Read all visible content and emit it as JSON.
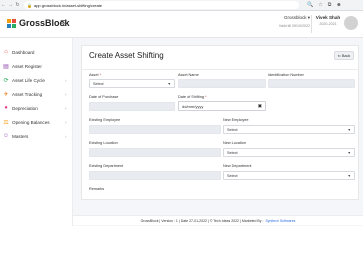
{
  "browser": {
    "url": "app.grossblock.in/asset-shifting/create"
  },
  "header": {
    "brand": "GrossBlock",
    "company_name": "Grossblock",
    "company_caret": "▾",
    "fiscal_year": "Valid till 09/10/2022",
    "user_name": "Vivek Shah",
    "user_year": "2020-2021"
  },
  "sidebar": {
    "items": [
      {
        "label": "Dashboard",
        "icon": "home-icon",
        "glyph": "⌂",
        "color": "#e74c3c",
        "chevron": false
      },
      {
        "label": "Asset Register",
        "icon": "register-icon",
        "glyph": "▤",
        "color": "#8e44ad",
        "chevron": false
      },
      {
        "label": "Asset Life Cycle",
        "icon": "lifecycle-icon",
        "glyph": "⟳",
        "color": "#27ae60",
        "chevron": true
      },
      {
        "label": "Asset Tracking",
        "icon": "tracking-icon",
        "glyph": "✈",
        "color": "#e67e22",
        "chevron": true
      },
      {
        "label": "Depreciation",
        "icon": "depreciation-icon",
        "glyph": "●",
        "color": "#e84393",
        "chevron": true
      },
      {
        "label": "Opening Balances",
        "icon": "balance-icon",
        "glyph": "⚖",
        "color": "#f39c12",
        "chevron": true
      },
      {
        "label": "Masters",
        "icon": "masters-icon",
        "glyph": "☺",
        "color": "#9b59b6",
        "chevron": true
      }
    ]
  },
  "form": {
    "title": "Create Asset Shifting",
    "back_label": "⇐ Back",
    "asset_label": "Asset",
    "asset_value": "Select",
    "asset_name_label": "Asset Name",
    "identification_label": "Identification Number",
    "purchase_label": "Date of Purchase",
    "shifting_label": "Date of Shifting",
    "shifting_placeholder": "dd/mm/yyyy",
    "existing_employee_label": "Existing Employee",
    "new_employee_label": "New Employee",
    "new_employee_value": "Select",
    "existing_location_label": "Existing Location",
    "new_location_label": "New Location",
    "new_location_value": "Select",
    "existing_department_label": "Existing Department",
    "new_department_label": "New Department",
    "new_department_value": "Select",
    "remarks_label": "Remarks"
  },
  "footer": {
    "text": "GrossBlock | Version : 1 | Date 27-01-2022 | © Tech Ideas 2022 | Marketed By :",
    "link": "Synitech Softwares"
  },
  "colors": {
    "logo": [
      "#f39c12",
      "#e74c3c",
      "#2980b9",
      "#27ae60"
    ]
  }
}
